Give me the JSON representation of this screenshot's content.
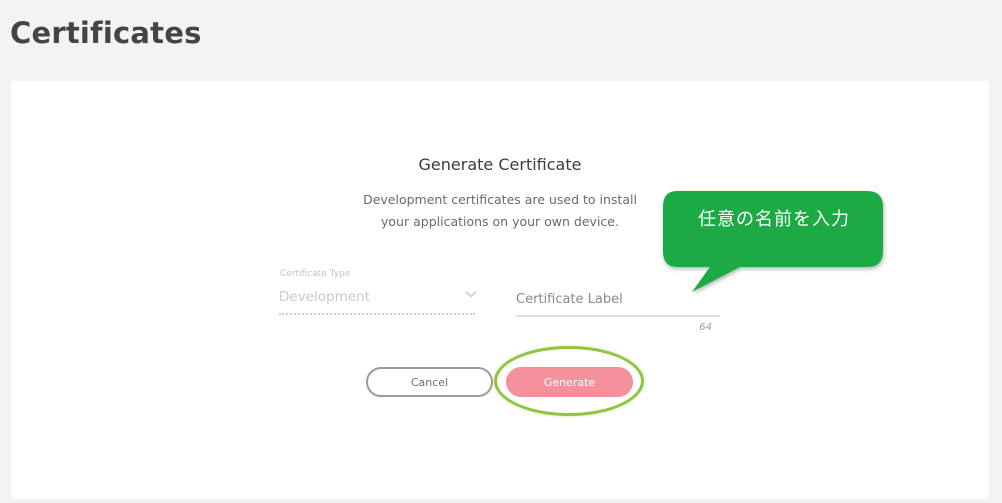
{
  "page": {
    "title": "Certificates"
  },
  "form": {
    "title": "Generate Certificate",
    "description_line1": "Development certificates are used to install",
    "description_line2": "your applications on your own device.",
    "type_field": {
      "label": "Certificate Type",
      "value": "Development",
      "icon": "chevron-down-icon"
    },
    "label_field": {
      "placeholder": "Certificate Label",
      "value": "",
      "max_chars": "64"
    },
    "buttons": {
      "cancel_label": "Cancel",
      "generate_label": "Generate"
    }
  },
  "annotation": {
    "callout_text": "任意の名前を入力",
    "callout_color": "#1aaa45",
    "highlight_color": "#8ec63f"
  },
  "colors": {
    "background": "#f3f3f3",
    "card": "#ffffff",
    "generate_button": "#f4919c"
  }
}
